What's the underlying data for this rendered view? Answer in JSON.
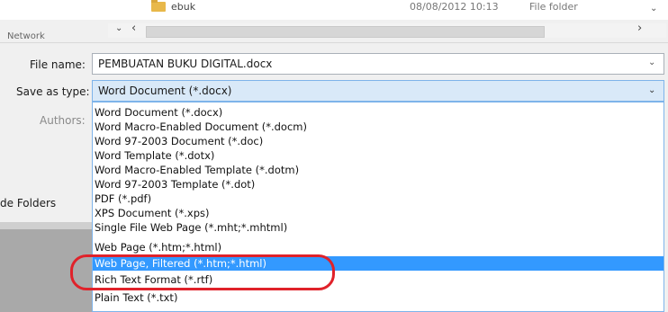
{
  "file_list": {
    "row_name": "ebuk",
    "row_date": "08/08/2012 10:13",
    "row_type": "File folder"
  },
  "side_label": "Network",
  "form": {
    "file_name_label": "File name:",
    "file_name_value": "PEMBUATAN BUKU DIGITAL.docx",
    "save_as_type_label": "Save as type:",
    "save_as_type_value": "Word Document (*.docx)",
    "authors_label": "Authors:",
    "hide_folders_label": "de Folders"
  },
  "save_as_type_options": [
    "Word Document (*.docx)",
    "Word Macro-Enabled Document (*.docm)",
    "Word 97-2003 Document (*.doc)",
    "Word Template (*.dotx)",
    "Word Macro-Enabled Template (*.dotm)",
    "Word 97-2003 Template (*.dot)",
    "PDF (*.pdf)",
    "XPS Document (*.xps)",
    "Single File Web Page (*.mht;*.mhtml)",
    "Web Page (*.htm;*.html)",
    "Web Page, Filtered (*.htm;*.html)",
    "Rich Text Format (*.rtf)",
    "Plain Text (*.txt)"
  ],
  "highlighted_option": "Web Page, Filtered (*.htm;*.html)",
  "colors": {
    "highlight": "#3399ff",
    "annotation": "#e0222a"
  }
}
